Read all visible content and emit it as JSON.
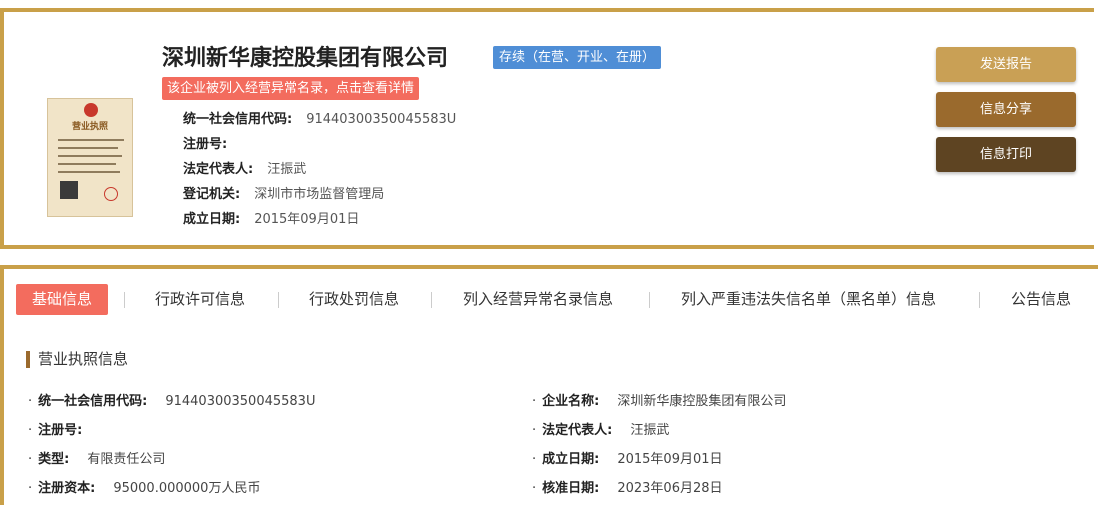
{
  "header": {
    "company_name": "深圳新华康控股集团有限公司",
    "status_badge": "存续（在营、开业、在册）",
    "abnormal_notice": "该企业被列入经营异常名录，点击查看详情",
    "info": [
      {
        "label": "统一社会信用代码:",
        "value": "91440300350045583U"
      },
      {
        "label": "注册号:",
        "value": ""
      },
      {
        "label": "法定代表人:",
        "value": "汪振武"
      },
      {
        "label": "登记机关:",
        "value": "深圳市市场监督管理局"
      },
      {
        "label": "成立日期:",
        "value": "2015年09月01日"
      }
    ],
    "license_title": "营业执照"
  },
  "actions": {
    "send_report": "发送报告",
    "share": "信息分享",
    "print": "信息打印"
  },
  "colors": {
    "gold": "#c9a049",
    "btn1": "#c9a055",
    "btn2": "#9a6a2d",
    "btn3": "#5e4422",
    "status_blue": "#4f8ed6",
    "alert_red": "#f36c5e"
  },
  "tabs": [
    {
      "label": "基础信息",
      "active": true
    },
    {
      "label": "行政许可信息",
      "active": false
    },
    {
      "label": "行政处罚信息",
      "active": false
    },
    {
      "label": "列入经营异常名录信息",
      "active": false
    },
    {
      "label": "列入严重违法失信名单（黑名单）信息",
      "active": false
    },
    {
      "label": "公告信息",
      "active": false
    }
  ],
  "section": {
    "title": "营业执照信息",
    "left": [
      {
        "label": "统一社会信用代码:",
        "value": "91440300350045583U"
      },
      {
        "label": "注册号:",
        "value": ""
      },
      {
        "label": "类型:",
        "value": "有限责任公司"
      },
      {
        "label": "注册资本:",
        "value": "95000.000000万人民币"
      }
    ],
    "right": [
      {
        "label": "企业名称:",
        "value": "深圳新华康控股集团有限公司"
      },
      {
        "label": "法定代表人:",
        "value": "汪振武"
      },
      {
        "label": "成立日期:",
        "value": "2015年09月01日"
      },
      {
        "label": "核准日期:",
        "value": "2023年06月28日"
      }
    ]
  }
}
